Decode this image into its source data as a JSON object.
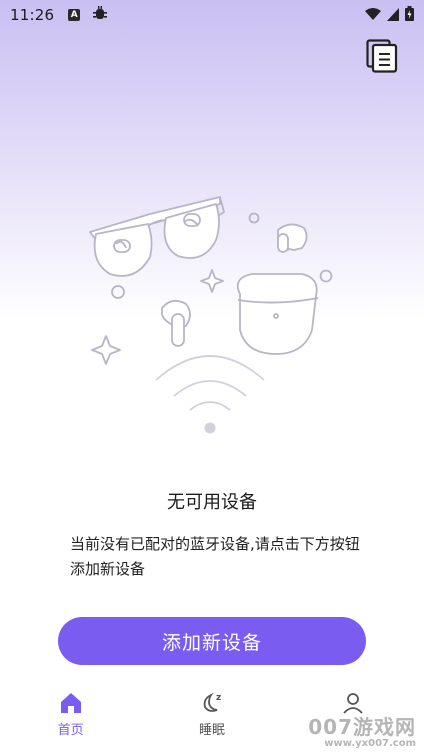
{
  "status_bar": {
    "time": "11:26",
    "icons": [
      "a-notification-icon",
      "bug-icon",
      "wifi-icon",
      "signal-icon",
      "battery-icon"
    ]
  },
  "header": {
    "doc_icon": "document-list-icon"
  },
  "empty_state": {
    "title": "无可用设备",
    "description": "当前没有已配对的蓝牙设备,请点击下方按钮添加新设备"
  },
  "primary_action": {
    "label": "添加新设备"
  },
  "tabbar": {
    "tabs": [
      {
        "label": "首页",
        "icon": "home-icon",
        "active": true
      },
      {
        "label": "睡眠",
        "icon": "moon-sleep-icon",
        "active": false
      },
      {
        "label": "",
        "icon": "profile-icon",
        "active": false
      }
    ]
  },
  "watermark": {
    "main": "007游戏网",
    "url": "www.yx007.com"
  },
  "colors": {
    "accent": "#7b5cf0",
    "gradient_top": "#c9bff2"
  }
}
